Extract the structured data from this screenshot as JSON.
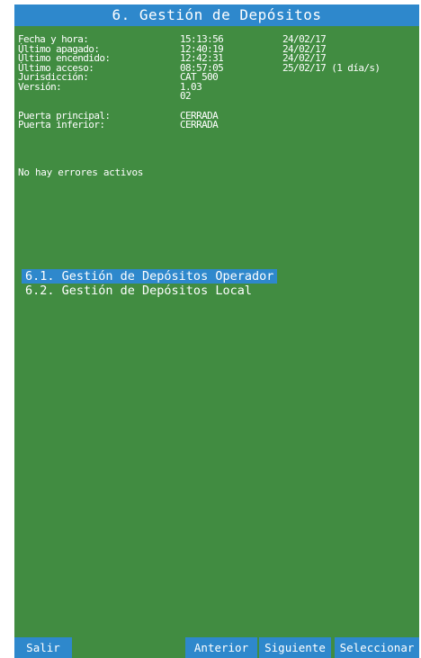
{
  "title": "6. Gestión de Depósitos",
  "info_rows": [
    {
      "label": "Fecha y hora:",
      "value": "15:13:56",
      "extra": "24/02/17"
    },
    {
      "label": "Último apagado:",
      "value": "12:40:19",
      "extra": "24/02/17"
    },
    {
      "label": "Último encendido:",
      "value": "12:42:31",
      "extra": "24/02/17"
    },
    {
      "label": "Último acceso:",
      "value": "08:57:05",
      "extra": "25/02/17 (1 día/s)"
    },
    {
      "label": "Jurisdicción:",
      "value": "CAT 500",
      "extra": ""
    },
    {
      "label": "Versión:",
      "value": "1.03",
      "extra": ""
    },
    {
      "label": "",
      "value": "02",
      "extra": ""
    }
  ],
  "door_rows": [
    {
      "label": "Puerta principal:",
      "value": "CERRADA"
    },
    {
      "label": "Puerta inferior:",
      "value": "CERRADA"
    }
  ],
  "errors_text": "No hay errores activos",
  "menu": [
    {
      "label": "6.1. Gestión de Depósitos Operador",
      "selected": true
    },
    {
      "label": "6.2. Gestión de Depósitos Local",
      "selected": false
    }
  ],
  "buttons": {
    "exit": "Salir",
    "previous": "Anterior",
    "next": "Siguiente",
    "select": "Seleccionar"
  },
  "colors": {
    "background": "#418c41",
    "accent": "#2e88cc",
    "text": "#ffffff"
  }
}
